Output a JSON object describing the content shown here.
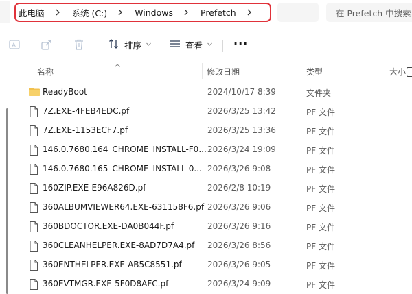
{
  "breadcrumb": {
    "items": [
      "此电脑",
      "系统 (C:)",
      "Windows",
      "Prefetch"
    ]
  },
  "search": {
    "placeholder": "在 Prefetch 中搜索"
  },
  "toolbar": {
    "sort_label": "排序",
    "view_label": "查看",
    "more_label": "···"
  },
  "columns": {
    "name": "名称",
    "date": "修改日期",
    "type": "类型",
    "size": "大小"
  },
  "files": [
    {
      "name": "ReadyBoot",
      "date": "2024/10/17 8:39",
      "type": "文件夹",
      "icon": "folder-icon"
    },
    {
      "name": "7Z.EXE-4FEB4EDC.pf",
      "date": "2026/3/25 13:42",
      "type": "PF 文件",
      "icon": "file-icon"
    },
    {
      "name": "7Z.EXE-1153ECF7.pf",
      "date": "2026/3/25 13:36",
      "type": "PF 文件",
      "icon": "file-icon"
    },
    {
      "name": "146.0.7680.164_CHROME_INSTALL-F0...",
      "date": "2026/3/24 19:09",
      "type": "PF 文件",
      "icon": "file-icon"
    },
    {
      "name": "146.0.7680.165_CHROME_INSTALL-0...",
      "date": "2026/3/26 9:08",
      "type": "PF 文件",
      "icon": "file-icon"
    },
    {
      "name": "160ZIP.EXE-E96A826D.pf",
      "date": "2026/2/8 10:19",
      "type": "PF 文件",
      "icon": "file-icon"
    },
    {
      "name": "360ALBUMVIEWER64.EXE-631158F6.pf",
      "date": "2026/3/26 9:06",
      "type": "PF 文件",
      "icon": "file-icon"
    },
    {
      "name": "360BDOCTOR.EXE-DA0B044F.pf",
      "date": "2026/3/26 9:16",
      "type": "PF 文件",
      "icon": "file-icon"
    },
    {
      "name": "360CLEANHELPER.EXE-8AD7D7A4.pf",
      "date": "2026/3/26 8:56",
      "type": "PF 文件",
      "icon": "file-icon"
    },
    {
      "name": "360ENTHELPER.EXE-AB5C8551.pf",
      "date": "2026/3/26 9:05",
      "type": "PF 文件",
      "icon": "file-icon"
    },
    {
      "name": "360EVTMGR.EXE-5F0D8AFC.pf",
      "date": "2026/3/24 9:09",
      "type": "PF 文件",
      "icon": "file-icon"
    }
  ],
  "colors": {
    "highlight_border": "#e0323a",
    "folder": "#f2c14e"
  }
}
